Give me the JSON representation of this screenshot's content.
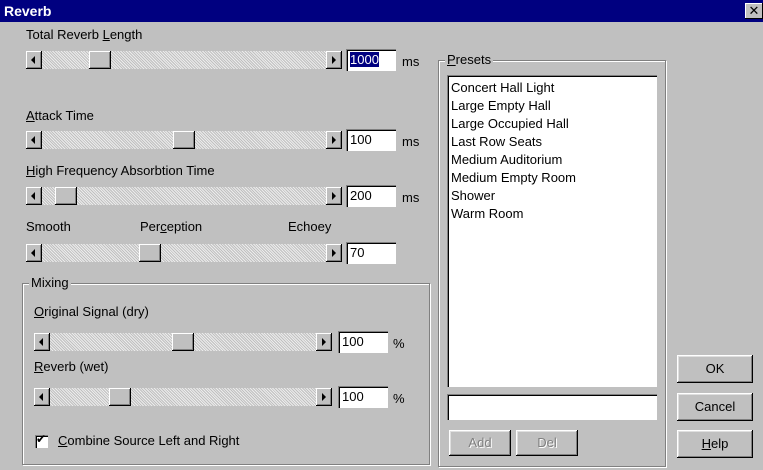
{
  "window": {
    "title": "Reverb",
    "close_glyph": "✕"
  },
  "sliders": {
    "total_reverb_length": {
      "label_pre": "Total Reverb ",
      "label_u": "L",
      "label_post": "ength",
      "value": "1000",
      "unit": "ms",
      "level": 0.18
    },
    "attack_time": {
      "label_pre": "",
      "label_u": "A",
      "label_post": "ttack Time",
      "value": "100",
      "unit": "ms",
      "level": 0.5
    },
    "high_freq_absorption": {
      "label_pre": "",
      "label_u": "H",
      "label_post": "igh Frequency Absorbtion Time",
      "value": "200",
      "unit": "ms",
      "level": 0.05
    },
    "perception": {
      "left_label": "Smooth",
      "mid_pre": "Per",
      "mid_u": "c",
      "mid_post": "eption",
      "right_label": "Echoey",
      "value": "70",
      "level": 0.37
    },
    "original_signal": {
      "label_pre": "",
      "label_u": "O",
      "label_post": "riginal Signal (dry)",
      "value": "100",
      "unit": "%",
      "level": 0.5
    },
    "reverb_wet": {
      "label_pre": "",
      "label_u": "R",
      "label_post": "everb (wet)",
      "value": "100",
      "unit": "%",
      "level": 0.24
    }
  },
  "mixing": {
    "group_label": "Mixing"
  },
  "combine": {
    "checked": true,
    "label_u": "C",
    "label_post": "ombine Source Left and Right"
  },
  "presets": {
    "group_label_u": "P",
    "group_label_post": "resets",
    "items": [
      "Concert Hall Light",
      "Large Empty Hall",
      "Large Occupied Hall",
      "Last Row Seats",
      "Medium Auditorium",
      "Medium Empty Room",
      "Shower",
      "Warm Room"
    ],
    "name_input": "",
    "add_label": "Add",
    "del_label": "Del"
  },
  "buttons": {
    "ok": "OK",
    "cancel": "Cancel",
    "help_u": "H",
    "help_post": "elp"
  }
}
